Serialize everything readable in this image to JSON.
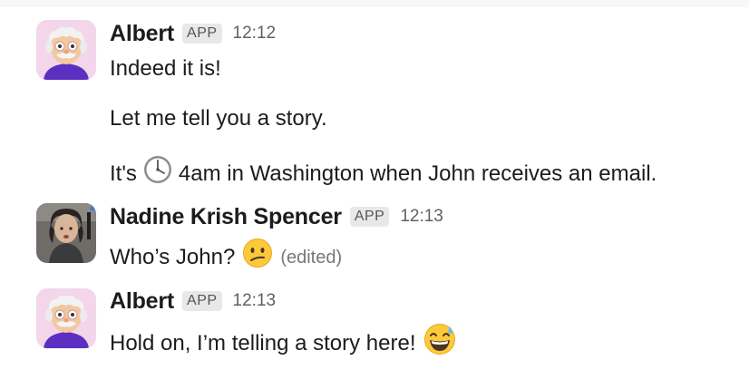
{
  "messages": [
    {
      "author": "Albert",
      "badge": "APP",
      "time": "12:12",
      "avatar_icon": "grandpa-avatar",
      "lines": [
        "Indeed it is!",
        "Let me tell you a story.",
        {
          "pre": "It's",
          "icon": "clock-four-icon",
          "post": "4am in Washington when John receives an email."
        }
      ]
    },
    {
      "author": "Nadine Krish Spencer",
      "badge": "APP",
      "time": "12:13",
      "avatar_icon": "photo-avatar",
      "lines": [
        {
          "text": "Who’s John?",
          "icon": "confused-face-emoji",
          "edited": "(edited)"
        }
      ]
    },
    {
      "author": "Albert",
      "badge": "APP",
      "time": "12:13",
      "avatar_icon": "grandpa-avatar",
      "lines": [
        {
          "text": "Hold on, I’m telling a story here!",
          "icon": "grinning-sweat-emoji"
        }
      ]
    }
  ],
  "colors": {
    "text": "#1d1c1d",
    "timestamp": "#616061",
    "badge_bg": "#e8e8e8",
    "avatar_bg": "#f3d6ea",
    "shirt": "#5b2fc0"
  }
}
